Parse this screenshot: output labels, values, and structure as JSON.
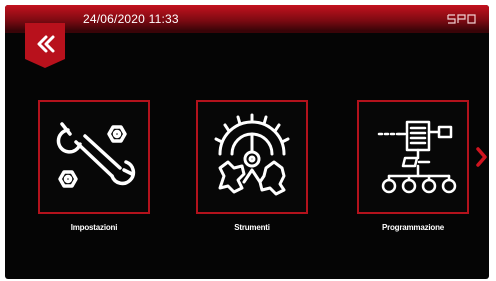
{
  "header": {
    "datetime": "24/06/2020 11:33",
    "brand_logo": "logo-icon"
  },
  "navigation": {
    "back_icon": "double-chevron-left-icon",
    "next_icon": "chevron-right-icon"
  },
  "tiles": [
    {
      "label": "Impostazioni",
      "icon": "wrench-bolts-icon"
    },
    {
      "label": "Strumenti",
      "icon": "gears-icon"
    },
    {
      "label": "Programmazione",
      "icon": "network-flow-icon"
    }
  ],
  "colors": {
    "accent": "#c4121e",
    "background": "#050505",
    "text": "#ffffff"
  }
}
